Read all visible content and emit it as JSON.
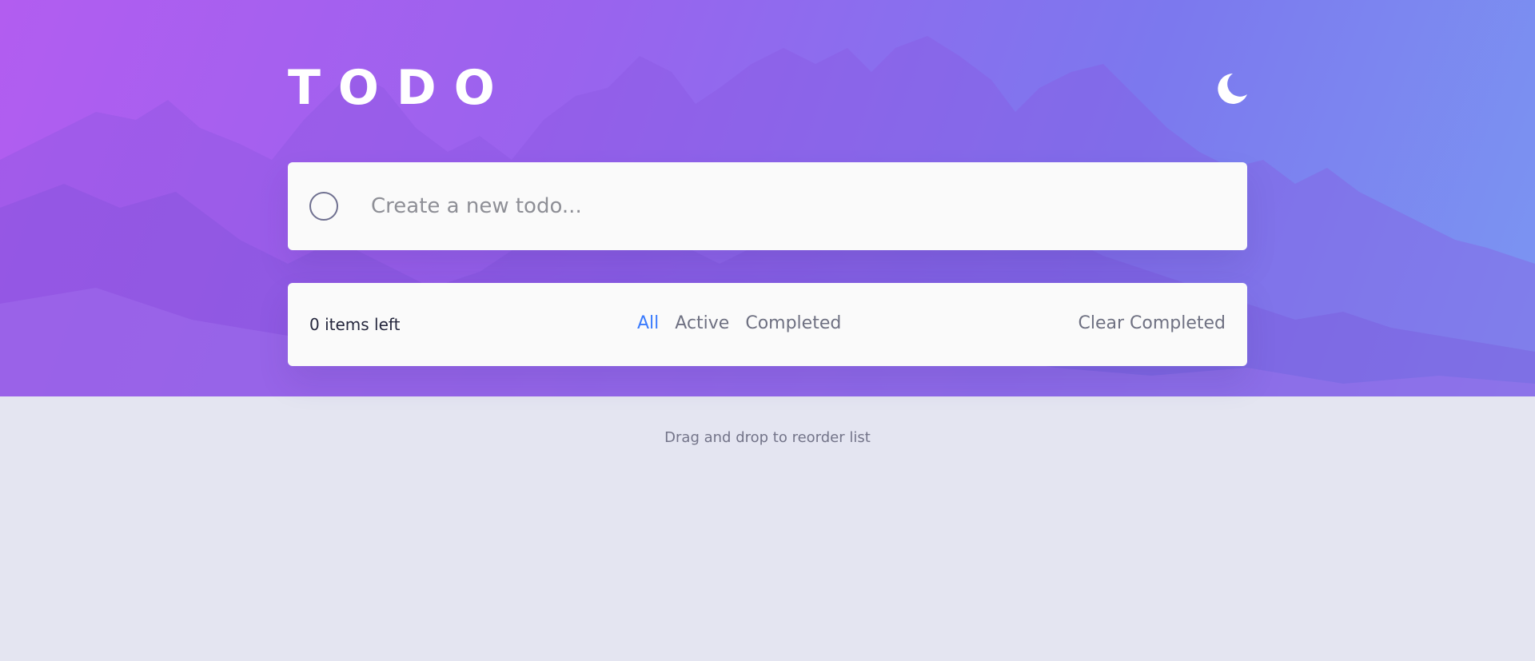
{
  "header": {
    "title": "TODO",
    "theme_icon": "moon-icon"
  },
  "new_todo": {
    "placeholder": "Create a new todo..."
  },
  "footer": {
    "items_left": "0 items left",
    "filters": [
      {
        "label": "All",
        "active": true
      },
      {
        "label": "Active",
        "active": false
      },
      {
        "label": "Completed",
        "active": false
      }
    ],
    "clear_label": "Clear Completed"
  },
  "hint": "Drag and drop to reorder list",
  "colors": {
    "accent": "#3a7bfd",
    "page_background": "#e4e5f1",
    "gradient_start": "#b25df0",
    "gradient_end": "#7b96f2"
  }
}
